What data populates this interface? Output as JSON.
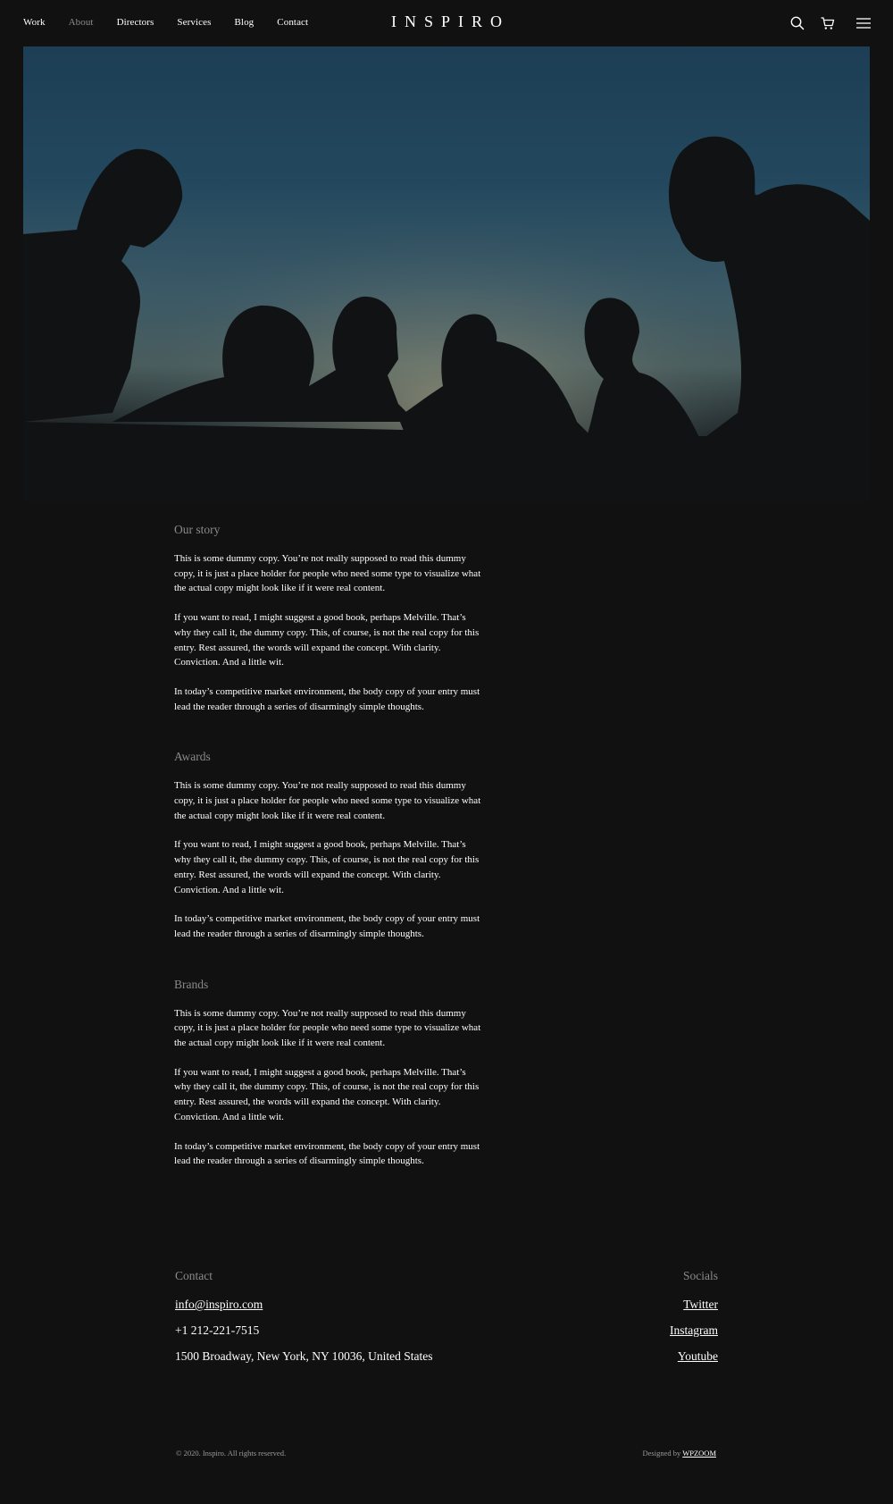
{
  "nav": {
    "items": [
      {
        "label": "Work",
        "active": false
      },
      {
        "label": "About",
        "active": true
      },
      {
        "label": "Directors",
        "active": false
      },
      {
        "label": "Services",
        "active": false
      },
      {
        "label": "Blog",
        "active": false
      },
      {
        "label": "Contact",
        "active": false
      }
    ]
  },
  "brand": {
    "name": "INSPIRO"
  },
  "header_icons": [
    "search-icon",
    "cart-icon",
    "menu-icon"
  ],
  "hero": {
    "image": "silhouettes of a group of people against a dusk sky"
  },
  "sections": [
    {
      "heading": "Our story",
      "paragraphs": [
        "This is some dummy copy. You’re not really supposed to read this dummy copy, it is just a place holder for people who need some type to visualize what the actual copy might look like if it were real content.",
        "If you want to read, I might suggest a good book, perhaps Melville. That’s why they call it, the dummy copy. This, of course, is not the real copy for this entry. Rest assured, the words will expand the concept. With clarity. Conviction. And a little wit.",
        "In today’s competitive market environment, the body copy of your entry must lead the reader through a series of disarmingly simple thoughts."
      ]
    },
    {
      "heading": "Awards",
      "paragraphs": [
        "This is some dummy copy. You’re not really supposed to read this dummy copy, it is just a place holder for people who need some type to visualize what the actual copy might look like if it were real content.",
        "If you want to read, I might suggest a good book, perhaps Melville. That’s why they call it, the dummy copy. This, of course, is not the real copy for this entry. Rest assured, the words will expand the concept. With clarity. Conviction. And a little wit.",
        "In today’s competitive market environment, the body copy of your entry must lead the reader through a series of disarmingly simple thoughts."
      ]
    },
    {
      "heading": "Brands",
      "paragraphs": [
        "This is some dummy copy. You’re not really supposed to read this dummy copy, it is just a place holder for people who need some type to visualize what the actual copy might look like if it were real content.",
        "If you want to read, I might suggest a good book, perhaps Melville. That’s why they call it, the dummy copy. This, of course, is not the real copy for this entry. Rest assured, the words will expand the concept. With clarity. Conviction. And a little wit.",
        "In today’s competitive market environment, the body copy of your entry must lead the reader through a series of disarmingly simple thoughts."
      ]
    }
  ],
  "footer": {
    "contact": {
      "heading": "Contact",
      "email": "info@inspiro.com",
      "phone": "+1 212-221-7515",
      "address": "1500 Broadway, New York, NY 10036, United States"
    },
    "socials": {
      "heading": "Socials",
      "links": [
        "Twitter",
        "Instagram",
        "Youtube"
      ]
    },
    "copyright": "© 2020. Inspiro. All rights reserved.",
    "credit_prefix": "Designed by ",
    "credit_link": "WPZOOM"
  },
  "colors": {
    "background": "#111111",
    "text": "#ffffff",
    "muted": "#8a8a8a"
  }
}
